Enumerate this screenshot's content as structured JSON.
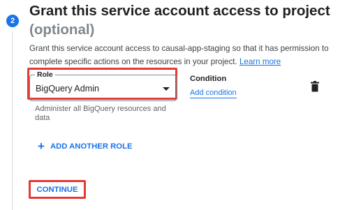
{
  "step": {
    "number": "2",
    "title": "Grant this service account access to project",
    "subtitle": "(optional)"
  },
  "description": {
    "text": "Grant this service account access to causal-app-staging so that it has permission to complete specific actions on the resources in your project. ",
    "link": "Learn more"
  },
  "role": {
    "label": "Role",
    "value": "BigQuery Admin",
    "helper": "Administer all BigQuery resources and data"
  },
  "condition": {
    "label": "Condition",
    "link": "Add condition"
  },
  "actions": {
    "add_role": "ADD ANOTHER ROLE",
    "add_role_icon": "+",
    "continue": "CONTINUE"
  },
  "colors": {
    "accent": "#1a73e8",
    "highlight": "#e53935"
  }
}
